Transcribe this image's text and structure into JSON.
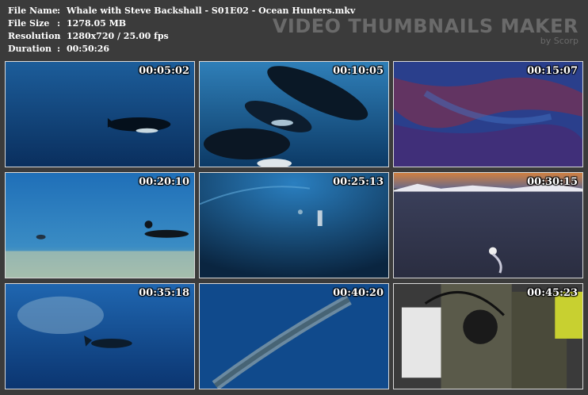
{
  "info": {
    "rows": [
      {
        "label": "File Name",
        "value": "Whale with Steve Backshall - S01E02 - Ocean Hunters.mkv"
      },
      {
        "label": "File Size",
        "value": "1278.05 MB"
      },
      {
        "label": "Resolution",
        "value": "1280x720 / 25.00 fps"
      },
      {
        "label": "Duration",
        "value": "00:50:26"
      }
    ]
  },
  "watermark": {
    "title": "VIDEO THUMBNAILS MAKER",
    "subtitle": "by Scorp"
  },
  "thumbnails": [
    {
      "timestamp": "00:05:02",
      "scene": "orca-open-water"
    },
    {
      "timestamp": "00:10:05",
      "scene": "orca-pod"
    },
    {
      "timestamp": "00:15:07",
      "scene": "red-ripples"
    },
    {
      "timestamp": "00:20:10",
      "scene": "diver-shallow"
    },
    {
      "timestamp": "00:25:13",
      "scene": "deep-blue-diver"
    },
    {
      "timestamp": "00:30:15",
      "scene": "sunset-sea"
    },
    {
      "timestamp": "00:35:18",
      "scene": "fish-school"
    },
    {
      "timestamp": "00:40:20",
      "scene": "whale-aerial"
    },
    {
      "timestamp": "00:45:23",
      "scene": "camera-operator"
    }
  ]
}
